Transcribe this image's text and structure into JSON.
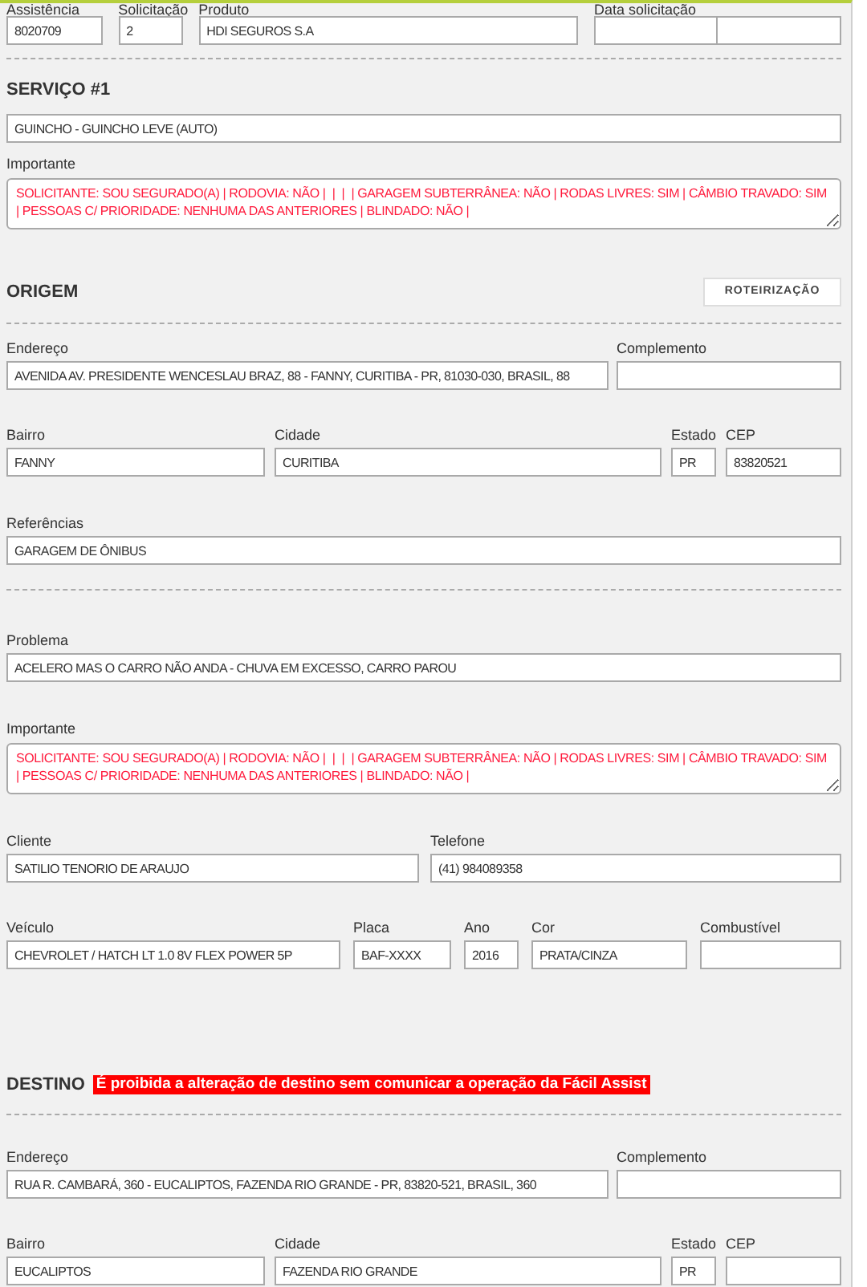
{
  "header": {
    "fields": [
      {
        "label": "Assistência",
        "value": "8020709"
      },
      {
        "label": "Solicitação",
        "value": "2"
      },
      {
        "label": "Produto",
        "value": "HDI SEGUROS S.A"
      },
      {
        "label": "Data solicitação",
        "kind": "split"
      }
    ]
  },
  "service": {
    "title": "SERVIÇO #1",
    "type": {
      "value": "GUINCHO - GUINCHO LEVE (AUTO)"
    },
    "important": {
      "label": "Importante",
      "value": "SOLICITANTE: SOU SEGURADO(A) | RODOVIA: NÃO |  |  |  | GARAGEM SUBTERRÂNEA: NÃO | RODAS LIVRES: SIM | CÂMBIO TRAVADO: SIM | PESSOAS C/ PRIORIDADE: NENHUMA DAS ANTERIORES | BLINDADO: NÃO |"
    }
  },
  "origin": {
    "title": "ORIGEM",
    "button": "ROTEIRIZAÇÃO",
    "address": {
      "label": "Endereço",
      "value": "AVENIDA AV. PRESIDENTE WENCESLAU BRAZ, 88 - FANNY, CURITIBA - PR, 81030-030, BRASIL, 88"
    },
    "complement": {
      "label": "Complemento"
    },
    "neighborhood": {
      "label": "Bairro",
      "value": "FANNY"
    },
    "city": {
      "label": "Cidade",
      "value": "CURITIBA"
    },
    "state": {
      "label": "Estado",
      "value": "PR"
    },
    "zip": {
      "label": "CEP",
      "value": "83820521"
    },
    "references": {
      "label": "Referências",
      "value": "GARAGEM DE ÔNIBUS"
    }
  },
  "details": {
    "problem": {
      "label": "Problema",
      "value": "ACELERO MAS O CARRO NÃO ANDA - CHUVA EM EXCESSO, CARRO PAROU"
    },
    "important": {
      "label": "Importante",
      "value": "SOLICITANTE: SOU SEGURADO(A) | RODOVIA: NÃO |  |  |  | GARAGEM SUBTERRÂNEA: NÃO | RODAS LIVRES: SIM | CÂMBIO TRAVADO: SIM | PESSOAS C/ PRIORIDADE: NENHUMA DAS ANTERIORES | BLINDADO: NÃO |"
    },
    "client": {
      "label": "Cliente",
      "value": "SATILIO TENORIO DE ARAUJO"
    },
    "phone": {
      "label": "Telefone",
      "value": "(41) 984089358"
    },
    "vehicle": {
      "label": "Veículo",
      "value": "CHEVROLET / HATCH LT 1.0 8V FLEX POWER 5P"
    },
    "plate": {
      "label": "Placa",
      "value": "BAF-XXXX"
    },
    "year": {
      "label": "Ano",
      "value": "2016"
    },
    "vehicle_color": {
      "label": "Cor",
      "value": "PRATA/CINZA"
    },
    "fuel": {
      "label": "Combustível"
    }
  },
  "destination": {
    "title": "DESTINO",
    "notice": "É proibida a alteração de destino sem comunicar a operação da Fácil Assist",
    "address": {
      "label": "Endereço",
      "value": "RUA R. CAMBARÁ, 360 - EUCALIPTOS, FAZENDA RIO GRANDE - PR, 83820-521, BRASIL, 360"
    },
    "complement": {
      "label": "Complemento"
    },
    "neighborhood": {
      "label": "Bairro",
      "value": "EUCALIPTOS"
    },
    "city": {
      "label": "Cidade",
      "value": "FAZENDA RIO GRANDE"
    },
    "state": {
      "label": "Estado",
      "value": "PR"
    },
    "zip": {
      "label": "CEP"
    }
  }
}
